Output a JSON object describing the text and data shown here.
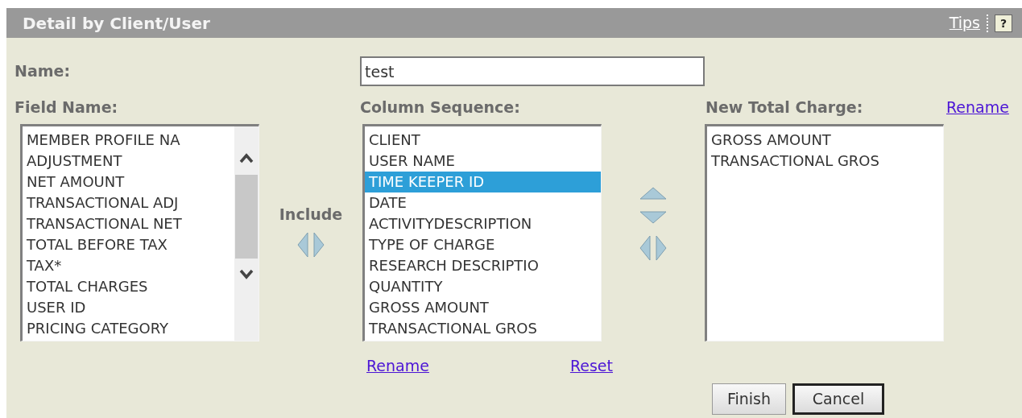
{
  "header": {
    "title": "Detail by Client/User",
    "tips_link": "Tips",
    "help_button": "?"
  },
  "name_label": "Name:",
  "name_value": "test",
  "field_list": {
    "label": "Field Name:",
    "items": [
      {
        "text": "MEMBER PROFILE NA",
        "selected": false
      },
      {
        "text": "ADJUSTMENT",
        "selected": false
      },
      {
        "text": "NET AMOUNT",
        "selected": false
      },
      {
        "text": "TRANSACTIONAL ADJ",
        "selected": false
      },
      {
        "text": "TRANSACTIONAL NET",
        "selected": false
      },
      {
        "text": "TOTAL BEFORE TAX",
        "selected": false
      },
      {
        "text": "TAX*",
        "selected": false
      },
      {
        "text": "TOTAL CHARGES",
        "selected": false
      },
      {
        "text": "USER ID",
        "selected": false
      },
      {
        "text": "PRICING CATEGORY",
        "selected": false
      }
    ]
  },
  "include_label": "Include",
  "column_list": {
    "label": "Column Sequence:",
    "items": [
      {
        "text": "CLIENT",
        "selected": false
      },
      {
        "text": "USER NAME",
        "selected": false
      },
      {
        "text": "TIME KEEPER ID",
        "selected": true
      },
      {
        "text": "DATE",
        "selected": false
      },
      {
        "text": "ACTIVITYDESCRIPTION",
        "selected": false
      },
      {
        "text": "TYPE OF CHARGE",
        "selected": false
      },
      {
        "text": "RESEARCH DESCRIPTIO",
        "selected": false
      },
      {
        "text": "QUANTITY",
        "selected": false
      },
      {
        "text": "GROSS AMOUNT",
        "selected": false
      },
      {
        "text": "TRANSACTIONAL GROS",
        "selected": false
      }
    ]
  },
  "column_links": [
    "Rename",
    "Reset"
  ],
  "total_list": {
    "label": "New Total Charge:",
    "link": "Rename",
    "items": [
      {
        "text": "GROSS AMOUNT",
        "selected": false
      },
      {
        "text": "TRANSACTIONAL GROS",
        "selected": false
      }
    ]
  },
  "buttons": [
    {
      "label": "Finish",
      "focused": false
    },
    {
      "label": "Cancel",
      "focused": true
    }
  ]
}
